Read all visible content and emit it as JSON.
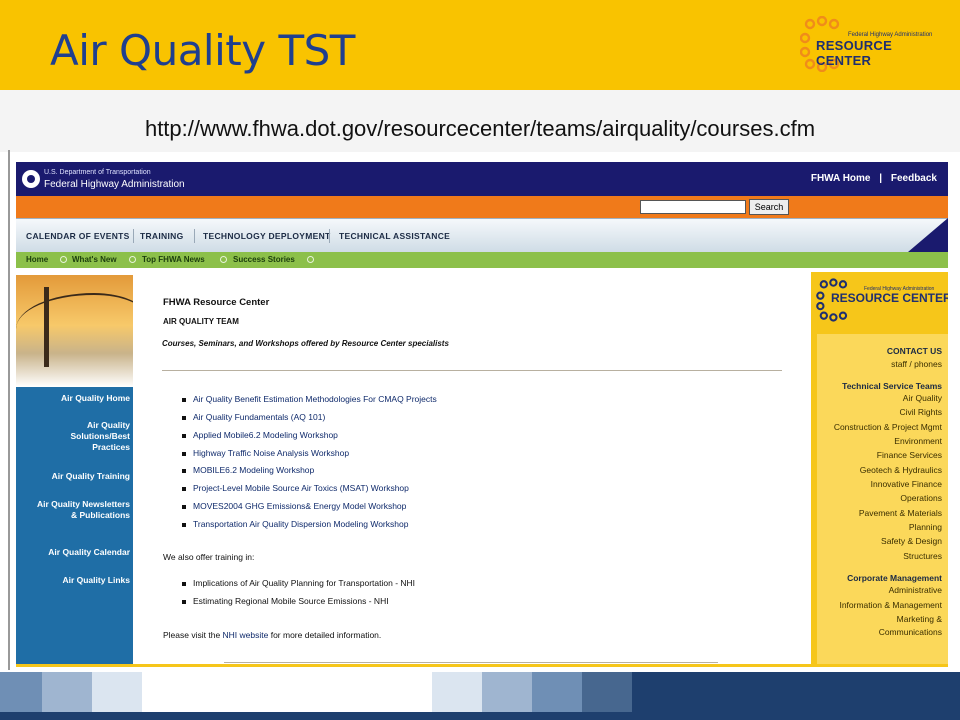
{
  "slide": {
    "title": "Air Quality TST",
    "url": "http://www.fhwa.dot.gov/resourcecenter/teams/airquality/courses.cfm",
    "logo_small": "Federal Highway Administration",
    "logo_big": "RESOURCE CENTER"
  },
  "site": {
    "agency_small": "U.S. Department of Transportation",
    "agency_big": "Federal Highway Administration",
    "top_links": [
      "FHWA Home",
      "|",
      "Feedback"
    ],
    "search_button": "Search",
    "menu": [
      "CALENDAR OF EVENTS",
      "TRAINING",
      "TECHNOLOGY DEPLOYMENT",
      "TECHNICAL ASSISTANCE"
    ],
    "green_nav": [
      "Home",
      "What's New",
      "Top FHWA News",
      "Success Stories"
    ]
  },
  "left_nav": [
    "Air Quality Home",
    "Air Quality Solutions/Best Practices",
    "Air Quality Training",
    "Air Quality Newsletters & Publications",
    "Air Quality Calendar",
    "Air Quality Links"
  ],
  "content": {
    "heading1": "FHWA Resource Center",
    "heading2": "AIR QUALITY TEAM",
    "subtitle": "Courses, Seminars, and Workshops offered by Resource Center specialists",
    "courses": [
      "Air Quality Benefit Estimation Methodologies For CMAQ Projects",
      "Air Quality Fundamentals (AQ 101)",
      "Applied Mobile6.2 Modeling Workshop",
      "Highway Traffic Noise Analysis Workshop",
      "MOBILE6.2 Modeling Workshop",
      "Project-Level Mobile Source Air Toxics (MSAT) Workshop",
      "MOVES2004 GHG Emissions& Energy Model Workshop",
      "Transportation Air Quality Dispersion Modeling Workshop"
    ],
    "also_offer": "We also offer training in:",
    "other": [
      "Implications of Air Quality Planning for Transportation - NHI",
      "Estimating Regional Mobile Source Emissions - NHI"
    ],
    "visit_prefix": "Please visit the ",
    "visit_link": "NHI website",
    "visit_suffix": " for more detailed information."
  },
  "right_panel": {
    "logo_small": "Federal Highway Administration",
    "logo_big": "RESOURCE CENTER",
    "contact": "CONTACT US",
    "staff": "staff / phones",
    "tech_heading": "Technical Service Teams",
    "teams": [
      "Air Quality",
      "Civil Rights",
      "Construction & Project Mgmt",
      "Environment",
      "Finance Services",
      "Geotech & Hydraulics",
      "Innovative Finance",
      "Operations",
      "Pavement & Materials",
      "Planning",
      "Safety & Design",
      "Structures"
    ],
    "corp_heading": "Corporate Management",
    "corp": [
      "Administrative",
      "Information & Management",
      "Marketing &",
      "Communications"
    ]
  },
  "colors": {
    "header_yellow": "#f9c300",
    "title_blue": "#1f3f8f",
    "nav_blue": "#1f6ea6",
    "orange": "#f07a1a",
    "green": "#8cc04a"
  }
}
